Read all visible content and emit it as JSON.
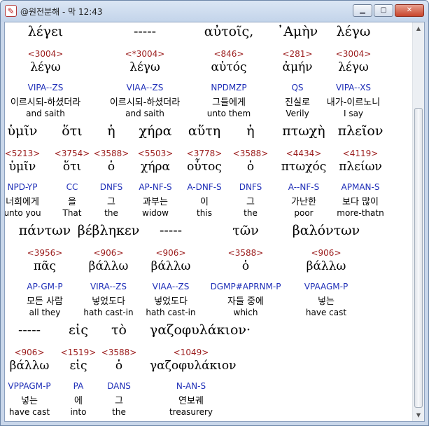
{
  "window": {
    "title": "@원전분해 - 막 12:43",
    "icon": "app-logo-icon",
    "buttons": {
      "minimize": "minimize-icon",
      "maximize": "maximize-icon",
      "close": "close-icon"
    }
  },
  "rows": [
    {
      "words": [
        {
          "greek": "λέγει",
          "strong": "<3004>",
          "lemma": "λέγω",
          "parse": "VIPA--ZS",
          "korean": "이르시되-하셨더라",
          "english": "and saith"
        },
        {
          "greek": "-----",
          "strong": "<*3004>",
          "lemma": "λέγω",
          "parse": "VIAA--ZS",
          "korean": "이르시되-하셨더라",
          "english": "and saith"
        },
        {
          "greek": "αὐτοῖς,",
          "strong": "<846>",
          "lemma": "αὐτός",
          "parse": "NPDMZP",
          "korean": "그들에게",
          "english": "unto them"
        },
        {
          "greek": "᾿Αμὴν",
          "strong": "<281>",
          "lemma": "ἀμήν",
          "parse": "QS",
          "korean": "진실로",
          "english": "Verily"
        },
        {
          "greek": "λέγω",
          "strong": "<3004>",
          "lemma": "λέγω",
          "parse": "VIPA--XS",
          "korean": "내가-이르노니",
          "english": "I say"
        }
      ]
    },
    {
      "words": [
        {
          "greek": "ὑμῖν",
          "strong": "<5213>",
          "lemma": "ὑμῖν",
          "parse": "NPD-YP",
          "korean": "너희에게",
          "english": "unto you"
        },
        {
          "greek": "ὅτι",
          "strong": "<3754>",
          "lemma": "ὅτι",
          "parse": "CC",
          "korean": "을",
          "english": "That"
        },
        {
          "greek": "ἡ",
          "strong": "<3588>",
          "lemma": "ὁ",
          "parse": "DNFS",
          "korean": "그",
          "english": "the"
        },
        {
          "greek": "χήρα",
          "strong": "<5503>",
          "lemma": "χήρα",
          "parse": "AP-NF-S",
          "korean": "과부는",
          "english": "widow"
        },
        {
          "greek": "αὕτη",
          "strong": "<3778>",
          "lemma": "οὗτος",
          "parse": "A-DNF-S",
          "korean": "이",
          "english": "this"
        },
        {
          "greek": "ἡ",
          "strong": "<3588>",
          "lemma": "ὁ",
          "parse": "DNFS",
          "korean": "그",
          "english": "the"
        },
        {
          "greek": "πτωχὴ",
          "strong": "<4434>",
          "lemma": "πτωχός",
          "parse": "A--NF-S",
          "korean": "가난한",
          "english": "poor"
        },
        {
          "greek": "πλεῖον",
          "strong": "<4119>",
          "lemma": "πλείων",
          "parse": "APMAN-S",
          "korean": "보다 많이",
          "english": "more-thatn"
        }
      ]
    },
    {
      "words": [
        {
          "greek": "πάντων",
          "strong": "<3956>",
          "lemma": "πᾶς",
          "parse": "AP-GM-P",
          "korean": "모든 사람",
          "english": "all they"
        },
        {
          "greek": "βέβληκεν",
          "strong": "<906>",
          "lemma": "βάλλω",
          "parse": "VIRA--ZS",
          "korean": "넣었도다",
          "english": "hath cast-in"
        },
        {
          "greek": "-----",
          "strong": "<906>",
          "lemma": "βάλλω",
          "parse": "VIAA--ZS",
          "korean": "넣었도다",
          "english": "hath cast-in"
        },
        {
          "greek": "τῶν",
          "strong": "<3588>",
          "lemma": "ὁ",
          "parse": "DGMP#APRNM-P",
          "korean": "자들 중에",
          "english": "which"
        },
        {
          "greek": "βαλόντων",
          "strong": "<906>",
          "lemma": "βάλλω",
          "parse": "VPAAGM-P",
          "korean": "넣는",
          "english": "have cast"
        }
      ]
    },
    {
      "words": [
        {
          "greek": "-----",
          "strong": "<906>",
          "lemma": "βάλλω",
          "parse": "VPPAGM-P",
          "korean": "넣는",
          "english": "have cast"
        },
        {
          "greek": "εἰς",
          "strong": "<1519>",
          "lemma": "εἰς",
          "parse": "PA",
          "korean": "에",
          "english": "into"
        },
        {
          "greek": "τὸ",
          "strong": "<3588>",
          "lemma": "ὁ",
          "parse": "DANS",
          "korean": "그",
          "english": "the"
        },
        {
          "greek": "γαζοφυλάκιον·",
          "strong": "<1049>",
          "lemma": "γαζοφυλάκιον",
          "parse": "N-AN-S",
          "korean": "연보궤",
          "english": "treasurery"
        }
      ]
    }
  ]
}
